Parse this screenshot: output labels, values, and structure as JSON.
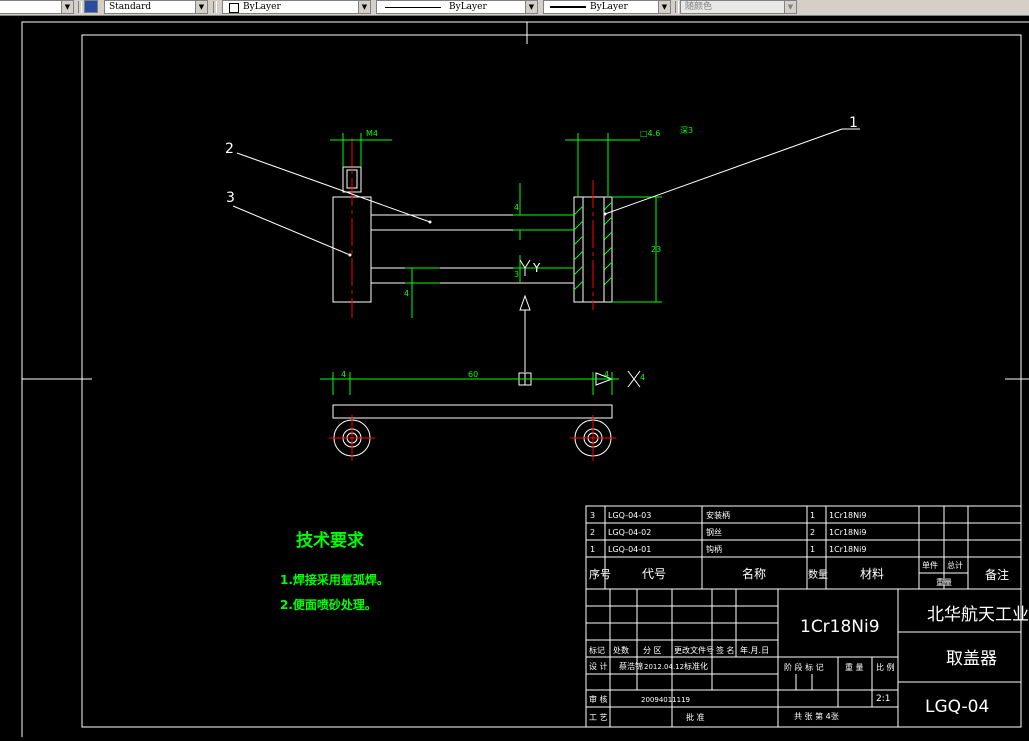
{
  "toolbar": {
    "text_style": "Standard",
    "layer": "ByLayer",
    "linetype": "ByLayer",
    "lineweight": "ByLayer",
    "plot_style": "随颜色"
  },
  "drawing": {
    "labels": {
      "balloon_1": "1",
      "balloon_2": "2",
      "balloon_3": "3",
      "dim_m4": "M4",
      "dim_sq": "□4.6",
      "dim_deep": "深3",
      "dim_4a": "4",
      "dim_23": "23",
      "dim_3": "3",
      "dim_4b": "4",
      "dim_4c": "4",
      "dim_60": "60",
      "dim_4d": "4",
      "axis_y": "Y",
      "axis_x": "X",
      "axis_x_num": "4"
    },
    "notes": {
      "title": "技术要求",
      "line1": "1.焊接采用氩弧焊。",
      "line2": "2.便面喷砂处理。"
    }
  },
  "bom": {
    "rows": [
      {
        "no": "3",
        "code": "LGQ-04-03",
        "name": "安装柄",
        "qty": "1",
        "material": "1Cr18Ni9"
      },
      {
        "no": "2",
        "code": "LGQ-04-02",
        "name": "钢丝",
        "qty": "2",
        "material": "1Cr18Ni9"
      },
      {
        "no": "1",
        "code": "LGQ-04-01",
        "name": "钩柄",
        "qty": "1",
        "material": "1Cr18Ni9"
      }
    ],
    "header": {
      "no": "序号",
      "code": "代号",
      "name": "名称",
      "qty": "数量",
      "material": "材料",
      "unit": "单件",
      "total": "总计",
      "weight": "重量",
      "remark": "备注"
    }
  },
  "title_block": {
    "material": "1Cr18Ni9",
    "company": "北华航天工业学院",
    "part_name": "取盖器",
    "drawing_no": "LGQ-04",
    "scale": "2:1",
    "rev_headers": [
      "标记",
      "处数",
      "分 区",
      "更改文件号",
      "签 名",
      "年.月.日"
    ],
    "design_label": "设 计",
    "designer": "蔡浩锦",
    "design_date": "2012.04.12",
    "standard_label": "标准化",
    "stage_label": "阶 段 标 记",
    "weight_label": "重 量",
    "scale_label": "比 例",
    "review_label": "审 核",
    "student_id": "20094011119",
    "process_label": "工 艺",
    "approve_label": "批 准",
    "sheets_text": "共    张  第  4张"
  },
  "colors": {
    "background": "#000000",
    "line": "#ffffff",
    "dimension": "#00ff00",
    "centerline": "#ff0000",
    "text_green": "#00ff00",
    "toolbar": "#d4d0c8"
  }
}
